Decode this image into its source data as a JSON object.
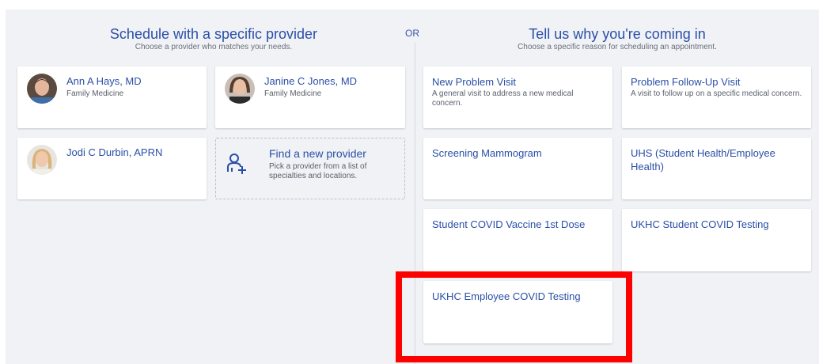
{
  "left": {
    "title": "Schedule with a specific provider",
    "subtitle": "Choose a provider who matches your needs."
  },
  "or_label": "OR",
  "right": {
    "title": "Tell us why you're coming in",
    "subtitle": "Choose a specific reason for scheduling an appointment."
  },
  "providers": [
    {
      "name": "Ann A Hays, MD",
      "specialty": "Family Medicine"
    },
    {
      "name": "Janine C Jones, MD",
      "specialty": "Family Medicine"
    },
    {
      "name": "Jodi C Durbin, APRN",
      "specialty": ""
    }
  ],
  "find_provider": {
    "title": "Find a new provider",
    "desc": "Pick a provider from a list of specialties and locations."
  },
  "reasons": [
    {
      "title": "New Problem Visit",
      "desc": "A general visit to address a new medical concern."
    },
    {
      "title": "Problem Follow-Up Visit",
      "desc": "A visit to follow up on a specific medical concern."
    },
    {
      "title": "Screening Mammogram",
      "desc": ""
    },
    {
      "title": "UHS (Student Health/Employee Health)",
      "desc": ""
    },
    {
      "title": "Student COVID Vaccine 1st Dose",
      "desc": ""
    },
    {
      "title": "UKHC Student COVID Testing",
      "desc": ""
    },
    {
      "title": "UKHC Employee COVID Testing",
      "desc": ""
    }
  ],
  "colors": {
    "accent": "#2a4fa6",
    "highlight": "#ff0000",
    "panel": "#f0f2f6"
  }
}
